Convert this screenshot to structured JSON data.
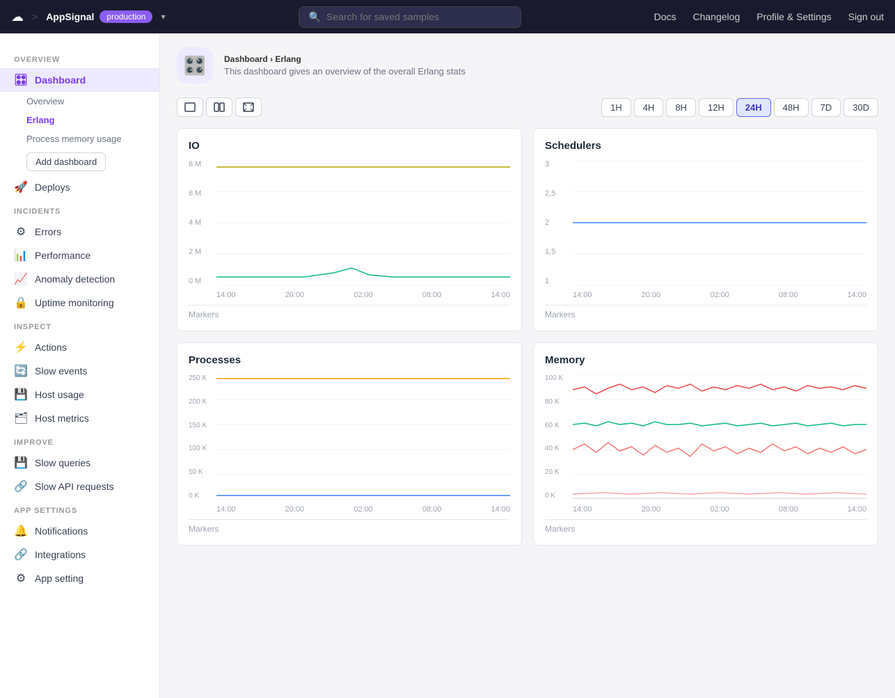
{
  "topnav": {
    "logo": "☁",
    "sep": ">",
    "app": "AppSignal",
    "env": "production",
    "search_placeholder": "Search for saved samples",
    "links": [
      "Docs",
      "Changelog",
      "Profile & Settings",
      "Sign out"
    ]
  },
  "sidebar": {
    "overview_label": "OVERVIEW",
    "dashboard_item": "Dashboard",
    "dashboard_subitems": [
      "Overview",
      "Erlang",
      "Process memory usage"
    ],
    "add_dashboard_label": "Add dashboard",
    "deploys_item": "Deploys",
    "incidents_label": "INCIDENTS",
    "errors_item": "Errors",
    "performance_item": "Performance",
    "anomaly_item": "Anomaly detection",
    "uptime_item": "Uptime monitoring",
    "inspect_label": "INSPECT",
    "actions_item": "Actions",
    "slow_events_item": "Slow events",
    "host_usage_item": "Host usage",
    "host_metrics_item": "Host metrics",
    "improve_label": "IMPROVE",
    "slow_queries_item": "Slow queries",
    "slow_api_item": "Slow API requests",
    "app_settings_label": "APP SETTINGS",
    "notifications_item": "Notifications",
    "integrations_item": "Integrations",
    "app_setting_item": "App setting"
  },
  "page": {
    "breadcrumb_parent": "Dashboard",
    "breadcrumb_sep": "›",
    "breadcrumb_current": "Erlang",
    "icon": "🎛",
    "subtitle": "This dashboard gives an overview of the overall Erlang stats"
  },
  "toolbar": {
    "btn_single": "▭",
    "btn_double": "▬",
    "btn_expand": "⛶",
    "time_buttons": [
      "1H",
      "4H",
      "8H",
      "12H",
      "24H",
      "48H",
      "7D",
      "30D"
    ],
    "active_time": "24H"
  },
  "charts": [
    {
      "id": "io",
      "title": "IO",
      "y_labels": [
        "8 M",
        "6 M",
        "4 M",
        "2 M",
        "0 M"
      ],
      "x_labels": [
        "14:00",
        "20:00",
        "02:00",
        "08:00",
        "14:00"
      ],
      "markers": "Markers"
    },
    {
      "id": "schedulers",
      "title": "Schedulers",
      "y_labels": [
        "3",
        "2,5",
        "2",
        "1,5",
        "1"
      ],
      "x_labels": [
        "14:00",
        "20:00",
        "02:00",
        "08:00",
        "14:00"
      ],
      "markers": "Markers"
    },
    {
      "id": "processes",
      "title": "Processes",
      "y_labels": [
        "250 K",
        "200 K",
        "150 K",
        "100 K",
        "50 K",
        "0 K"
      ],
      "x_labels": [
        "14:00",
        "20:00",
        "02:00",
        "08:00",
        "14:00"
      ],
      "markers": "Markers"
    },
    {
      "id": "memory",
      "title": "Memory",
      "y_labels": [
        "100 K",
        "80 K",
        "60 K",
        "40 K",
        "20 K",
        "0 K"
      ],
      "x_labels": [
        "14:00",
        "20:00",
        "02:00",
        "08:00",
        "14:00"
      ],
      "markers": "Markers"
    }
  ]
}
